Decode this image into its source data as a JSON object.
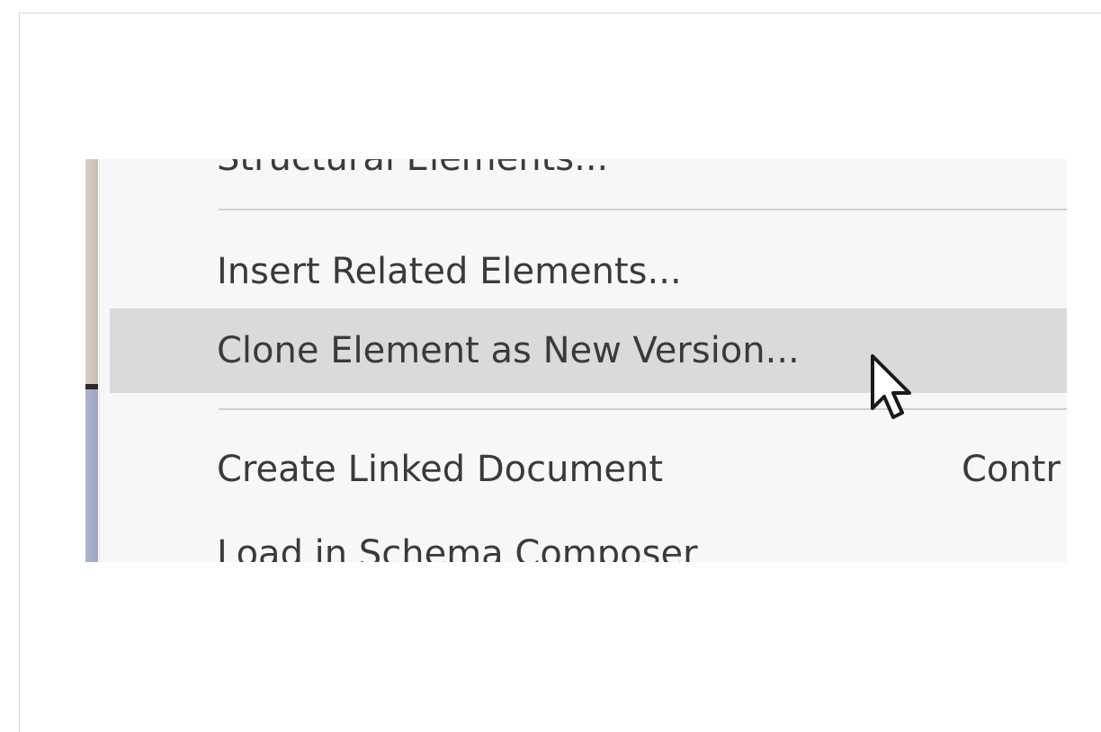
{
  "menu": {
    "items": [
      {
        "label": "Structural Elements..."
      },
      {
        "label": "Insert Related Elements..."
      },
      {
        "label": "Clone Element as New Version...",
        "highlighted": true
      },
      {
        "label": "Create Linked Document",
        "shortcut": "Contr"
      },
      {
        "label": "Load in Schema Composer"
      }
    ],
    "highlight_color": "#dadada",
    "text_color": "#3a3a3a"
  },
  "cursor": {
    "icon": "arrow-pointer-icon"
  }
}
